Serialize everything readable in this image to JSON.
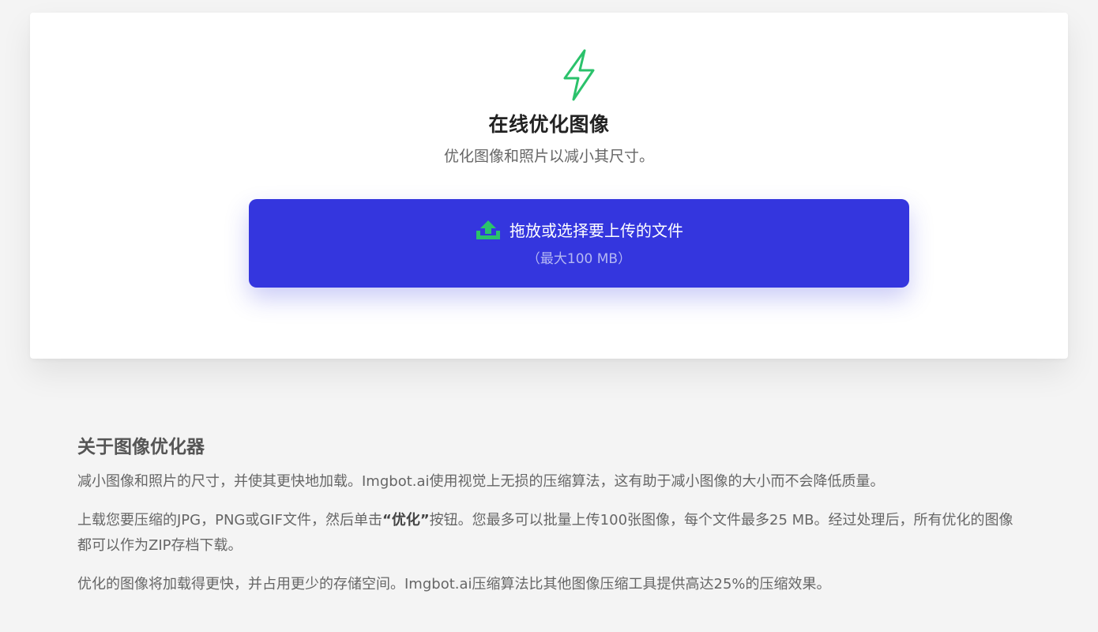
{
  "hero": {
    "icon": "lightning-bolt-icon",
    "title": "在线优化图像",
    "subtitle": "优化图像和照片以减小其尺寸。",
    "accent_color": "#2bc26b"
  },
  "upload": {
    "label": "拖放或选择要上传的文件",
    "limit": "（最大100 MB）",
    "button_color": "#3436de",
    "icon": "upload-icon"
  },
  "about": {
    "title": "关于图像优化器",
    "p1": "减小图像和照片的尺寸，并使其更快地加载。Imgbot.ai使用视觉上无损的压缩算法，这有助于减小图像的大小而不会降低质量。",
    "p2_before": "上载您要压缩的JPG，PNG或GIF文件，然后单击",
    "p2_bold": "“优化”",
    "p2_after": "按钮。您最多可以批量上传100张图像，每个文件最多25 MB。经过处理后，所有优化的图像都可以作为ZIP存档下载。",
    "p3": "优化的图像将加载得更快，并占用更少的存储空间。Imgbot.ai压缩算法比其他图像压缩工具提供高达25%的压缩效果。"
  }
}
